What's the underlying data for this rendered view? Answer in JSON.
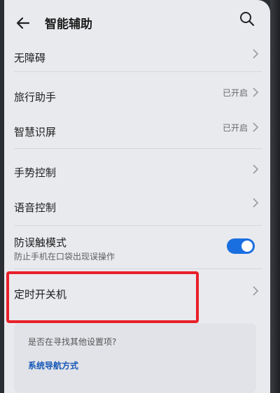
{
  "header": {
    "title": "智能辅助",
    "back_icon": "back-arrow-icon",
    "search_icon": "search-icon"
  },
  "settings": {
    "items": [
      {
        "label": "无障碍",
        "status": ""
      },
      {
        "label": "旅行助手",
        "status": "已开启"
      },
      {
        "label": "智慧识屏",
        "status": "已开启"
      },
      {
        "label": "手势控制",
        "status": ""
      },
      {
        "label": "语音控制",
        "status": ""
      }
    ],
    "mistouch": {
      "label": "防误触模式",
      "description": "防止手机在口袋出现误操作",
      "enabled": true
    },
    "timer": {
      "label": "定时开关机"
    }
  },
  "hint": {
    "question": "是否在寻找其他设置项?",
    "link": "系统导航方式"
  },
  "colors": {
    "accent": "#1a6fe0",
    "highlight": "#e8202a",
    "background": "#e9eaee"
  }
}
